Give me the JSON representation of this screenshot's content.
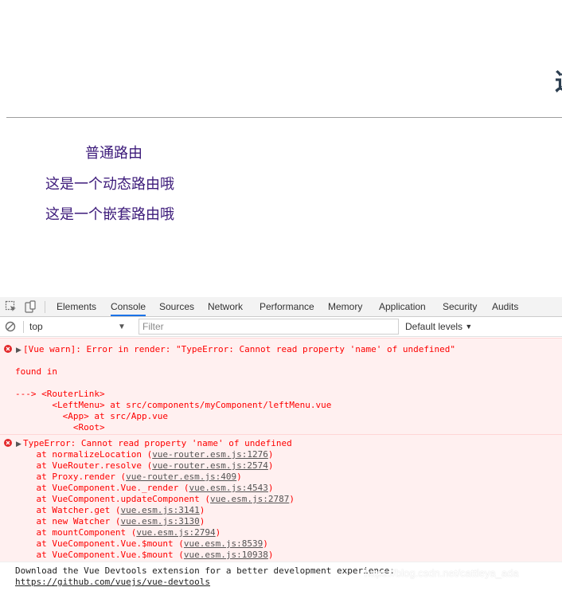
{
  "page": {
    "heading_char": "这",
    "links": [
      {
        "label": "普通路由"
      },
      {
        "label": "这是一个动态路由哦"
      },
      {
        "label": "这是一个嵌套路由哦"
      }
    ]
  },
  "devtools": {
    "tabs": [
      "Elements",
      "Console",
      "Sources",
      "Network",
      "Performance",
      "Memory",
      "Application",
      "Security",
      "Audits"
    ],
    "active_tab": "Console",
    "context": "top",
    "filter_placeholder": "Filter",
    "levels_label": "Default levels",
    "colors": {
      "error_text": "#fe0000",
      "error_bg": "#fff0f0",
      "active_tab": "#1a73e8"
    }
  },
  "console": {
    "error1": {
      "title": "[Vue warn]: Error in render: \"TypeError: Cannot read property 'name' of undefined\"",
      "found_in": "found in",
      "trace": [
        "---> <RouterLink>",
        "       <LeftMenu> at src/components/myComponent/leftMenu.vue",
        "         <App> at src/App.vue",
        "           <Root>"
      ]
    },
    "error2": {
      "title": "TypeError: Cannot read property 'name' of undefined",
      "stack": [
        {
          "fn": "    at normalizeLocation (",
          "src": "vue-router.esm.js:1276",
          "end": ")"
        },
        {
          "fn": "    at VueRouter.resolve (",
          "src": "vue-router.esm.js:2574",
          "end": ")"
        },
        {
          "fn": "    at Proxy.render (",
          "src": "vue-router.esm.js:409",
          "end": ")"
        },
        {
          "fn": "    at VueComponent.Vue._render (",
          "src": "vue.esm.js:4543",
          "end": ")"
        },
        {
          "fn": "    at VueComponent.updateComponent (",
          "src": "vue.esm.js:2787",
          "end": ")"
        },
        {
          "fn": "    at Watcher.get (",
          "src": "vue.esm.js:3141",
          "end": ")"
        },
        {
          "fn": "    at new Watcher (",
          "src": "vue.esm.js:3130",
          "end": ")"
        },
        {
          "fn": "    at mountComponent (",
          "src": "vue.esm.js:2794",
          "end": ")"
        },
        {
          "fn": "    at VueComponent.Vue.$mount (",
          "src": "vue.esm.js:8539",
          "end": ")"
        },
        {
          "fn": "    at VueComponent.Vue.$mount (",
          "src": "vue.esm.js:10938",
          "end": ")"
        }
      ]
    },
    "log": {
      "text": "Download the Vue Devtools extension for a better development experience:",
      "url": "https://github.com/vuejs/vue-devtools"
    }
  },
  "watermark": "https://blog.csdn.net/cattleya_ada"
}
